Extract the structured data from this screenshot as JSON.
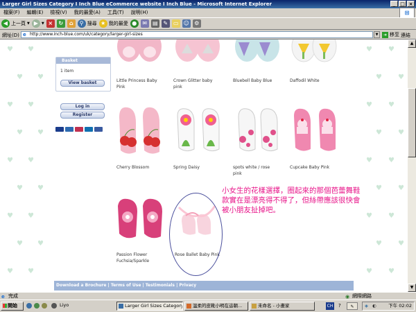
{
  "window": {
    "title": "Larger Girl Sizes Category I Inch Blue eCommerce website I Inch Blue - Microsoft Internet Explorer"
  },
  "menu": [
    "檔案(F)",
    "編輯(E)",
    "檢視(V)",
    "我的最愛(A)",
    "工具(T)",
    "說明(H)"
  ],
  "toolbar": {
    "back_label": "上一頁",
    "search_label": "搜尋",
    "favorites_label": "我的最愛"
  },
  "address": {
    "label": "網址(D)",
    "url": "http://www.inch-blue.com/uk/category/larger-girl-sizes",
    "go_label": "移至",
    "links_label": "連結"
  },
  "sidebar": {
    "basket_title": "Basket",
    "basket_count": "1 item",
    "view_basket_label": "View basket",
    "login_label": "Log in",
    "register_label": "Register"
  },
  "products": [
    {
      "name": "Little Princess Baby Pink"
    },
    {
      "name": "Crown Glitter baby pink"
    },
    {
      "name": "Bluebell Baby Blue"
    },
    {
      "name": "Daffodil White"
    },
    {
      "name": "Cherry Blossom"
    },
    {
      "name": "Spring Daisy"
    },
    {
      "name": "spots white / rose pink"
    },
    {
      "name": "Cupcake Baby Pink"
    },
    {
      "name": "Passion Flower Fuchsia/Sparkle"
    },
    {
      "name": "Rose Ballet Baby Pink"
    }
  ],
  "footer": {
    "links": "Download a Brochure | Terms of Use | Testimonials | Privacy"
  },
  "annotation": {
    "text": "小女生的花樣選擇，圈起來的那個芭蕾舞鞋款實在是漂亮得不得了，但絲帶應該很快會被小朋友扯掉吧。"
  },
  "statusbar": {
    "status": "完成",
    "zone": "網際網路"
  },
  "taskbar": {
    "start_label": "開始",
    "quick_app": "Liyo",
    "tasks": [
      "Larger Girl Sizes Category...",
      "溫柔的皮靴小明在這朝...",
      "未命名 - 小畫家"
    ],
    "clock": "下午 02:02"
  },
  "colors": {
    "titlebar": "#0a246a",
    "accent_blue": "#9db4d7",
    "annotation": "#e8168a",
    "background_hearts": "#cde7d7"
  }
}
